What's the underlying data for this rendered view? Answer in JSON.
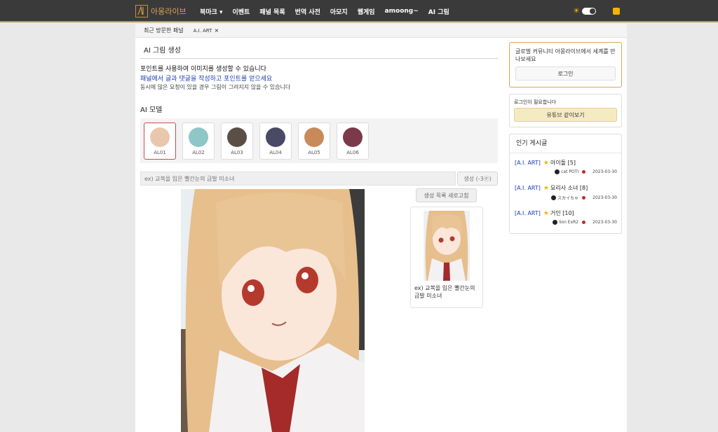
{
  "nav": {
    "logo_text": "아몽라이브",
    "items": [
      "북마크 ▾",
      "이벤트",
      "패널 목록",
      "번역 사전",
      "아모지",
      "웹게임",
      "amoong~",
      "AI 그림"
    ]
  },
  "recent": {
    "label": "최근 방문한 패널",
    "tag": "A.I. ART",
    "close": "×"
  },
  "main": {
    "title": "AI 그림 생성",
    "desc1": "포인트를 사용하여 이미지를 생성할 수 있습니다",
    "desc2": "패널에서 글과 댓글을 작성하고 포인트를 얻으세요",
    "desc3": "동시에 많은 요청이 있을 경우 그림이 그려지지 않을 수 있습니다"
  },
  "models": {
    "title": "AI 모델",
    "items": [
      {
        "label": "AL01",
        "color": "#e9c7ad",
        "selected": true
      },
      {
        "label": "AL02",
        "color": "#8fc6c8",
        "selected": false
      },
      {
        "label": "AL03",
        "color": "#5b4f45",
        "selected": false
      },
      {
        "label": "AL04",
        "color": "#4a4a66",
        "selected": false
      },
      {
        "label": "AL05",
        "color": "#c98a5a",
        "selected": false
      },
      {
        "label": "AL06",
        "color": "#7a3a4a",
        "selected": false
      }
    ]
  },
  "prompt": {
    "placeholder": "ex) 교복을 입은 빨간눈의 금발 미소녀",
    "button": "생성 (-3ⓟ)"
  },
  "history": {
    "button": "생성 목록 새로고침",
    "caption": "ex) 교복을 입은 빨간눈의 금발 미소녀"
  },
  "sidebar": {
    "login_text": "글로벌 커뮤니티 아몽라이브에서 세계를 만나보세요",
    "login_button": "로그인",
    "yt_text": "로그인이 필요합니다",
    "yt_button": "유튜브 같이보기",
    "popular_title": "인기 게시글",
    "posts": [
      {
        "tag": "[A.I. ART]",
        "title": "아이돌 [5]",
        "author": "cat POTI",
        "date": "2023-03-30"
      },
      {
        "tag": "[A.I. ART]",
        "title": "요리사 소녀 [8]",
        "author": "スカイちゃ",
        "date": "2023-03-30"
      },
      {
        "tag": "[A.I. ART]",
        "title": "거인 [10]",
        "author": "lion ExR2",
        "date": "2023-03-30"
      }
    ]
  },
  "colors": {
    "accent": "#c8913b",
    "nav_bg": "#3a3a3a",
    "link": "#1a3db0",
    "star": "#f5b400"
  }
}
